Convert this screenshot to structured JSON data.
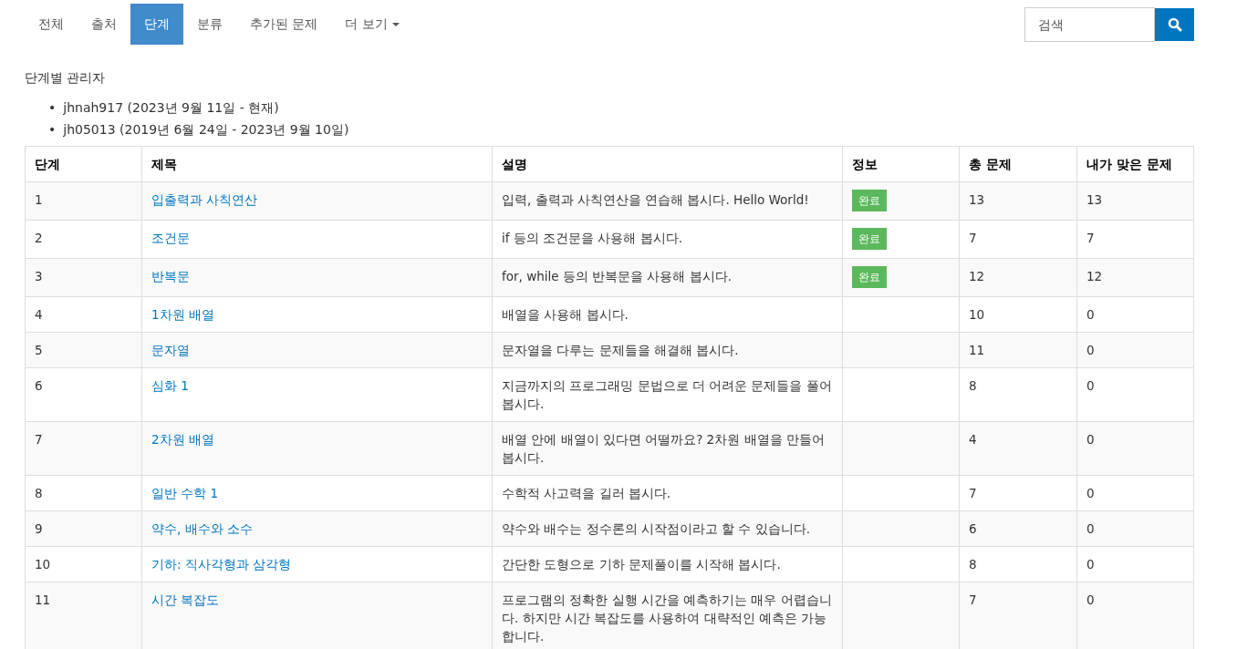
{
  "tabs": [
    {
      "label": "전체",
      "selected": false,
      "kind": "link"
    },
    {
      "label": "출처",
      "selected": false,
      "kind": "link"
    },
    {
      "label": "단계",
      "selected": true,
      "kind": "link"
    },
    {
      "label": "분류",
      "selected": false,
      "kind": "link"
    },
    {
      "label": "추가된 문제",
      "selected": false,
      "kind": "link"
    },
    {
      "label": "더 보기",
      "selected": false,
      "kind": "dropdown"
    }
  ],
  "search": {
    "placeholder": "검색"
  },
  "managers": {
    "heading": "단계별 관리자",
    "items": [
      {
        "bullet": "•",
        "text": "jhnah917 (2023년 9월 11일 - 현재)"
      },
      {
        "bullet": "•",
        "text": "jh05013 (2019년 6월 24일 - 2023년 9월 10일)"
      }
    ]
  },
  "table": {
    "columns": [
      "단계",
      "제목",
      "설명",
      "정보",
      "총 문제",
      "내가 맞은 문제"
    ],
    "rows": [
      {
        "step": "1",
        "title": "입출력과 사칙연산",
        "description": "입력, 출력과 사칙연산을 연습해 봅시다. Hello World!",
        "badge": "완료",
        "total": "13",
        "solved": "13"
      },
      {
        "step": "2",
        "title": "조건문",
        "description": "if 등의 조건문을 사용해 봅시다.",
        "badge": "완료",
        "total": "7",
        "solved": "7"
      },
      {
        "step": "3",
        "title": "반복문",
        "description": "for, while 등의 반복문을 사용해 봅시다.",
        "badge": "완료",
        "total": "12",
        "solved": "12"
      },
      {
        "step": "4",
        "title": "1차원 배열",
        "description": "배열을 사용해 봅시다.",
        "total": "10",
        "solved": "0"
      },
      {
        "step": "5",
        "title": "문자열",
        "description": "문자열을 다루는 문제들을 해결해 봅시다.",
        "total": "11",
        "solved": "0"
      },
      {
        "step": "6",
        "title": "심화 1",
        "description": "지금까지의 프로그래밍 문법으로 더 어려운 문제들을 풀어봅시다.",
        "total": "8",
        "solved": "0"
      },
      {
        "step": "7",
        "title": "2차원 배열",
        "description": "배열 안에 배열이 있다면 어떨까요? 2차원 배열을 만들어 봅시다.",
        "total": "4",
        "solved": "0"
      },
      {
        "step": "8",
        "title": "일반 수학 1",
        "description": "수학적 사고력을 길러 봅시다.",
        "total": "7",
        "solved": "0"
      },
      {
        "step": "9",
        "title": "약수, 배수와 소수",
        "description": "약수와 배수는 정수론의 시작점이라고 할 수 있습니다.",
        "total": "6",
        "solved": "0"
      },
      {
        "step": "10",
        "title": "기하: 직사각형과 삼각형",
        "description": "간단한 도형으로 기하 문제풀이를 시작해 봅시다.",
        "total": "8",
        "solved": "0"
      },
      {
        "step": "11",
        "title": "시간 복잡도",
        "description": "프로그램의 정확한 실행 시간을 예측하기는 매우 어렵습니다. 하지만 시간 복잡도를 사용하여 대략적인 예측은 가능합니다.",
        "total": "7",
        "solved": "0"
      }
    ]
  }
}
